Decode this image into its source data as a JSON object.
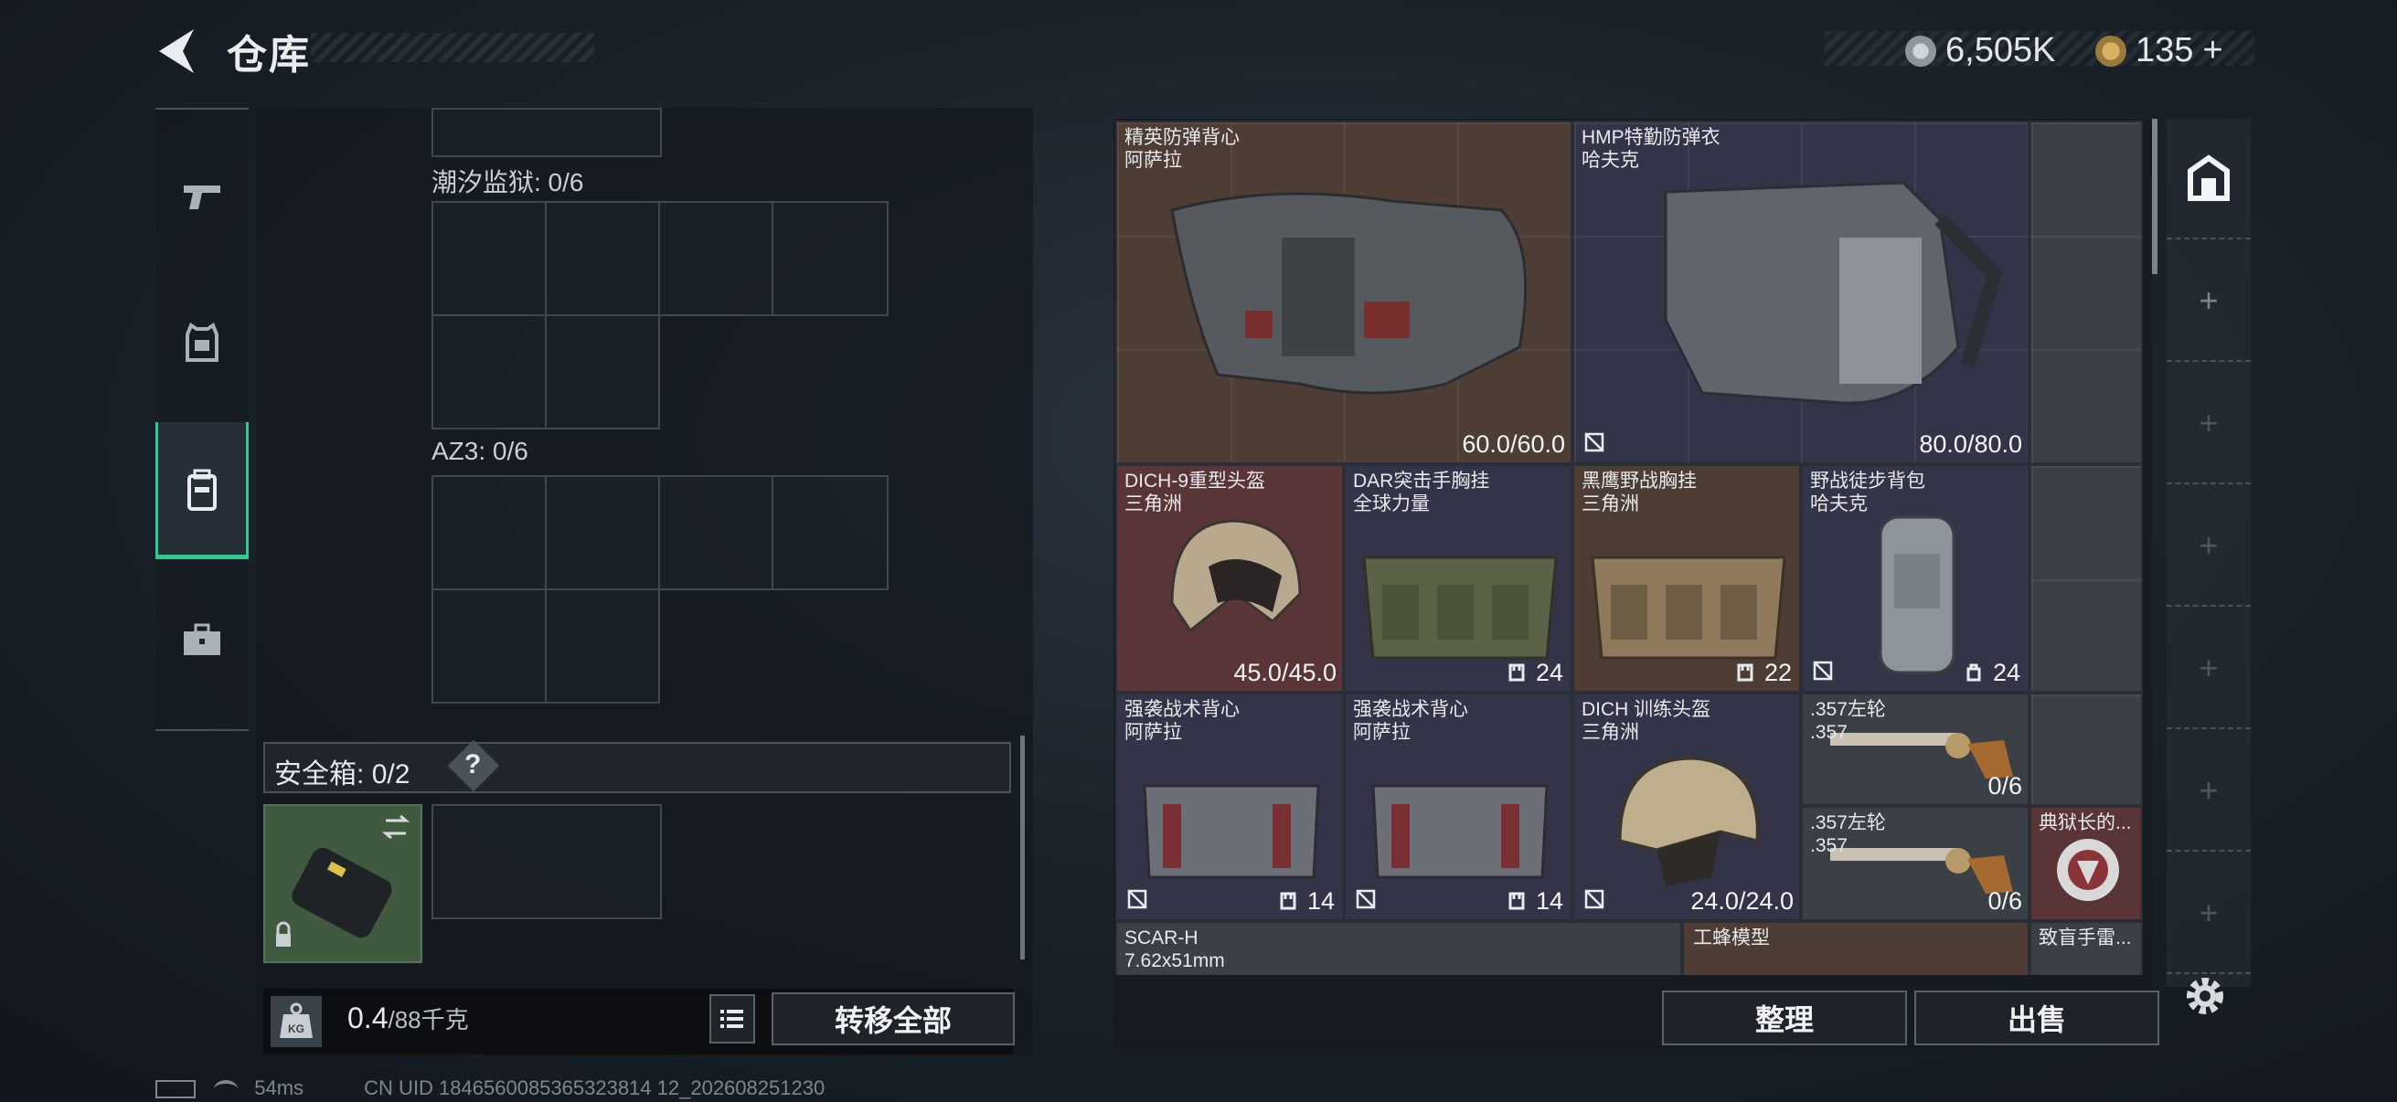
{
  "header": {
    "title": "仓库",
    "currency": [
      {
        "icon": "coin-icon",
        "value": "6,505K"
      },
      {
        "icon": "triangle-coin-icon",
        "value": "135",
        "plus": "+"
      }
    ]
  },
  "tabs": [
    {
      "icon": "pistol-icon",
      "name": "weapons"
    },
    {
      "icon": "armor-icon",
      "name": "armor"
    },
    {
      "icon": "backpack-icon",
      "name": "bag",
      "active": true
    },
    {
      "icon": "briefcase-icon",
      "name": "case"
    }
  ],
  "containers": [
    {
      "label": "潮汐监狱: 0/6"
    },
    {
      "label": "AZ3: 0/6"
    }
  ],
  "safe_box": {
    "label": "安全箱:",
    "value": "0/2",
    "help": "?"
  },
  "weight": {
    "value": "0.4",
    "max": "/88千克",
    "kg_label": "KG"
  },
  "buttons": {
    "transfer_all": "转移全部",
    "sort": "整理",
    "sell": "出售"
  },
  "inventory": [
    {
      "name": "精英防弹背心",
      "sub": "阿萨拉",
      "value": "60.0/60.0"
    },
    {
      "name": "HMP特勤防弹衣",
      "sub": "哈夫克",
      "value": "80.0/80.0"
    },
    {
      "name": "DICH-9重型头盔",
      "sub": "三角洲",
      "value": "45.0/45.0"
    },
    {
      "name": "DAR突击手胸挂",
      "sub": "全球力量",
      "count": "24"
    },
    {
      "name": "黑鹰野战胸挂",
      "sub": "三角洲",
      "count": "22"
    },
    {
      "name": "野战徒步背包",
      "sub": "哈夫克",
      "count": "24"
    },
    {
      "name": "强袭战术背心",
      "sub": "阿萨拉",
      "count": "14"
    },
    {
      "name": "强袭战术背心",
      "sub": "阿萨拉",
      "count": "14"
    },
    {
      "name": "DICH 训练头盔",
      "sub": "三角洲",
      "value": "24.0/24.0"
    },
    {
      "name": ".357左轮",
      "sub": ".357",
      "value": "0/6"
    },
    {
      "name": ".357左轮",
      "sub": ".357",
      "value": "0/6"
    },
    {
      "name": "典狱长的..."
    },
    {
      "name": "SCAR-H",
      "sub": "7.62x51mm"
    },
    {
      "name": "工蜂模型"
    },
    {
      "name": "致盲手雷..."
    }
  ],
  "status_bar": {
    "ping": "54ms",
    "uid": "CN UID 1846560085365323814 12_202608251230"
  }
}
